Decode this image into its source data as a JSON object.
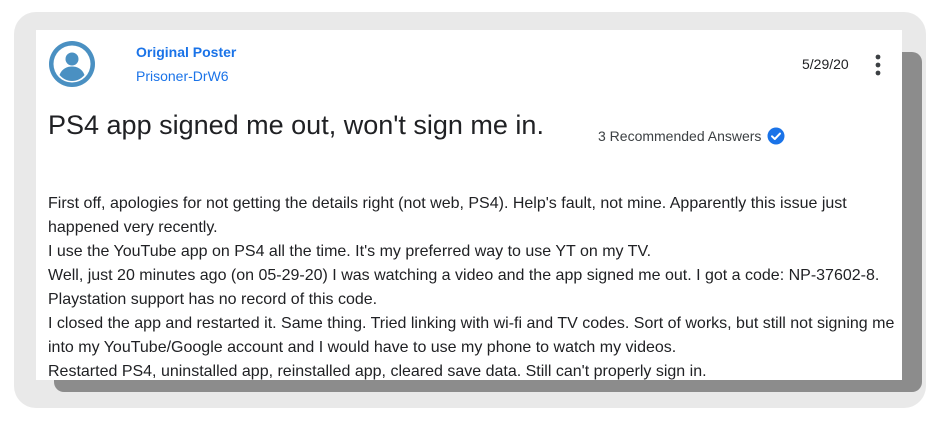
{
  "post": {
    "role": "Original Poster",
    "author": "Prisoner-DrW6",
    "date": "5/29/20",
    "title": "PS4 app signed me out, won't sign me in.",
    "recommended_answers": "3 Recommended Answers",
    "body": [
      "First off, apologies for not getting the details right (not web, PS4). Help's fault, not mine. Apparently this issue just happened very recently.",
      "I use the YouTube app on PS4 all the time. It's my preferred way to use YT on my TV.",
      "Well, just 20 minutes ago (on 05-29-20) I was watching a video and the app signed me out. I got a code: NP-37602-8. Playstation support has no record of this code.",
      "I closed the app and restarted it. Same thing. Tried linking with wi-fi and TV codes. Sort of works, but still not signing me into my YouTube/Google account and I would have to use my phone to watch my videos.",
      "Restarted PS4, uninstalled app, reinstalled app, cleared save data. Still can't properly sign in."
    ]
  },
  "icons": {
    "avatar": "account-circle-icon",
    "menu": "more-vert-icon",
    "recommended": "check-circle-icon"
  },
  "colors": {
    "accent": "#1a73e8",
    "avatar": "#4a90c2",
    "text": "#202124"
  }
}
